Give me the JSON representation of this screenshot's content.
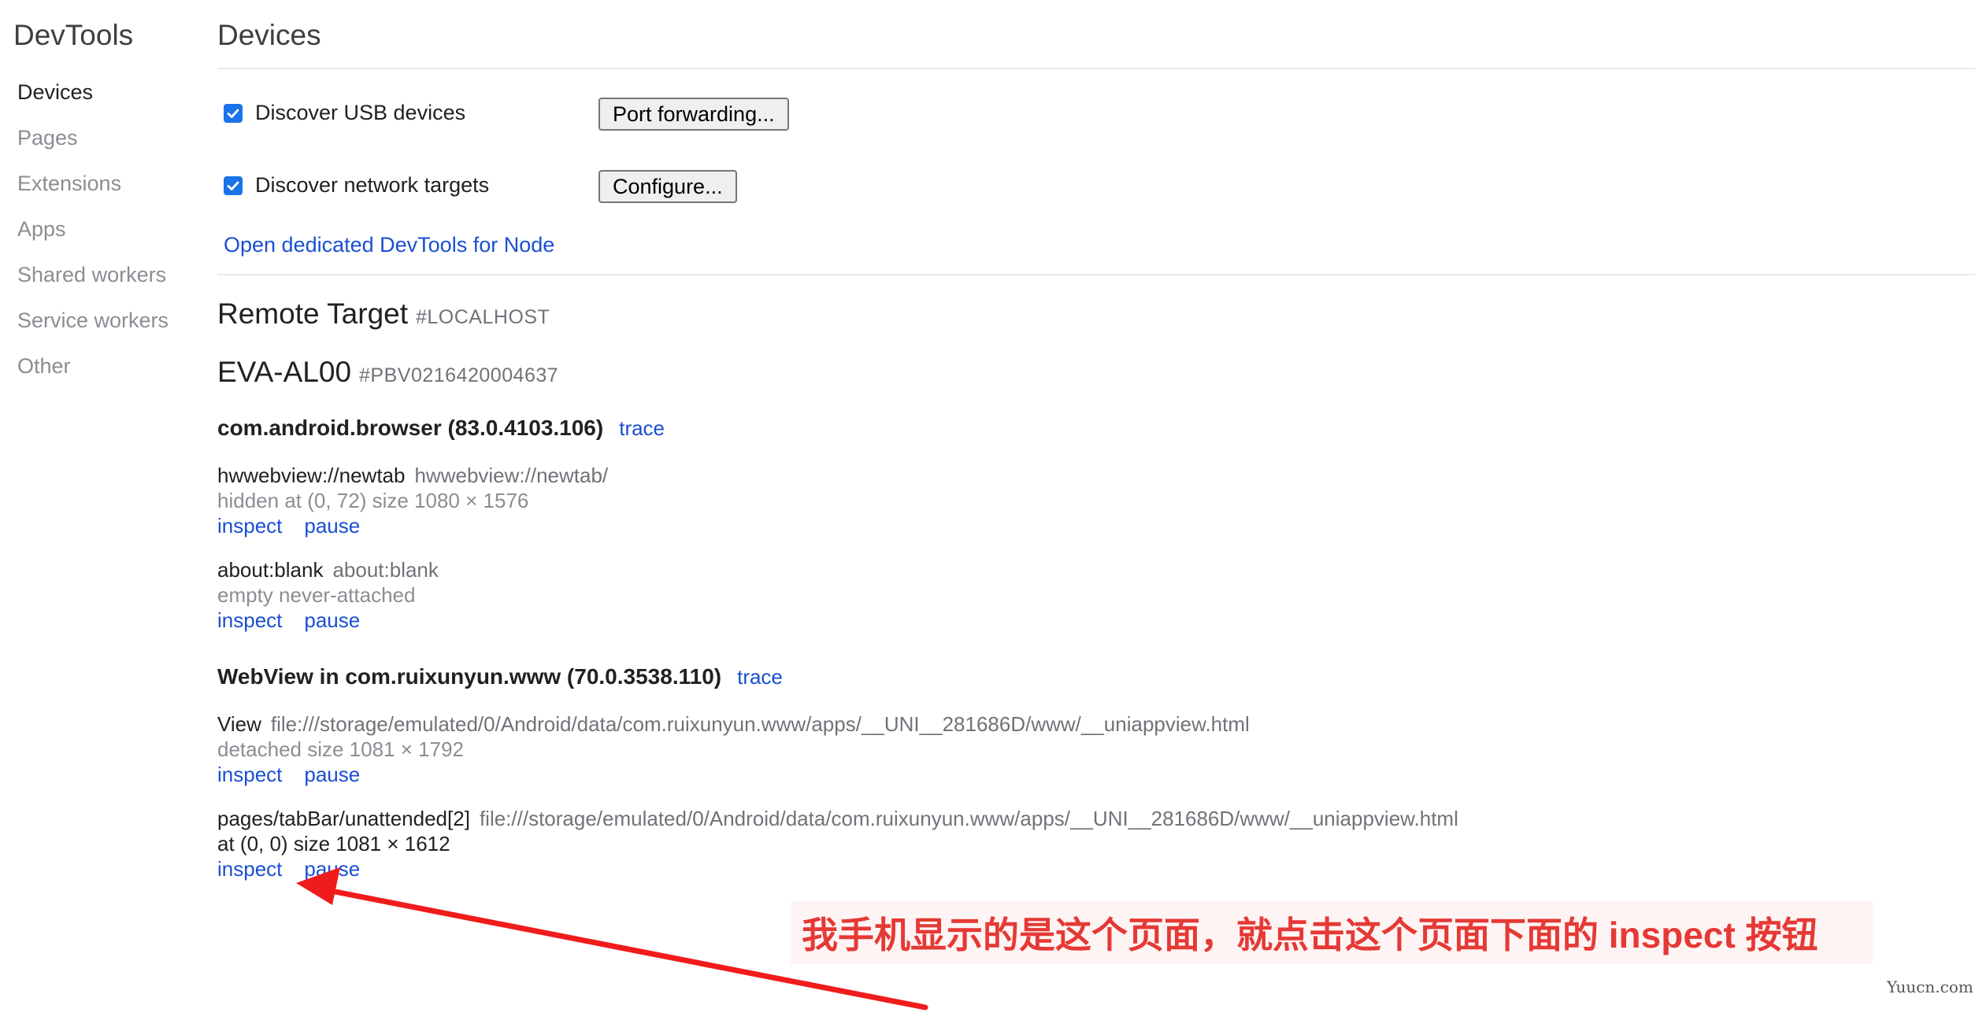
{
  "sidebar": {
    "title": "DevTools",
    "items": [
      {
        "label": "Devices",
        "active": true
      },
      {
        "label": "Pages",
        "active": false
      },
      {
        "label": "Extensions",
        "active": false
      },
      {
        "label": "Apps",
        "active": false
      },
      {
        "label": "Shared workers",
        "active": false
      },
      {
        "label": "Service workers",
        "active": false
      },
      {
        "label": "Other",
        "active": false
      }
    ]
  },
  "main": {
    "title": "Devices",
    "discover_usb": {
      "label": "Discover USB devices",
      "checked": true
    },
    "port_forwarding_button": "Port forwarding...",
    "discover_network": {
      "label": "Discover network targets",
      "checked": true
    },
    "configure_button": "Configure...",
    "open_node_devtools_link": "Open dedicated DevTools for Node",
    "remote_target": {
      "title": "Remote Target",
      "sub": "#LOCALHOST"
    },
    "device": {
      "name": "EVA-AL00",
      "serial": "#PBV0216420004637"
    },
    "browsers": [
      {
        "name": "com.android.browser (83.0.4103.106)",
        "trace": "trace",
        "targets": [
          {
            "name": "hwwebview://newtab",
            "url": "hwwebview://newtab/",
            "meta_gray": "hidden",
            "meta": "at (0, 72)  size 1080 × 1576",
            "inspect": "inspect",
            "pause": "pause"
          },
          {
            "name": "about:blank",
            "url": "about:blank",
            "meta_gray": "empty never-attached",
            "meta": "",
            "inspect": "inspect",
            "pause": "pause"
          }
        ]
      },
      {
        "name": "WebView in com.ruixunyun.www (70.0.3538.110)",
        "trace": "trace",
        "targets": [
          {
            "name": "View",
            "url": "file:///storage/emulated/0/Android/data/com.ruixunyun.www/apps/__UNI__281686D/www/__uniappview.html",
            "meta_gray": "detached",
            "meta": "size 1081 × 1792",
            "inspect": "inspect",
            "pause": "pause"
          },
          {
            "name": "pages/tabBar/unattended[2]",
            "url": "file:///storage/emulated/0/Android/data/com.ruixunyun.www/apps/__UNI__281686D/www/__uniappview.html",
            "meta_gray": "",
            "meta": "at (0, 0)  size 1081 × 1612",
            "inspect": "inspect",
            "pause": "pause"
          }
        ]
      }
    ]
  },
  "annotation": {
    "text": "我手机显示的是这个页面，就点击这个页面下面的 inspect 按钮",
    "color": "#e53935"
  },
  "watermark": "Yuucn.com",
  "colors": {
    "accent": "#1a73e8",
    "link": "#1a4fd1"
  }
}
